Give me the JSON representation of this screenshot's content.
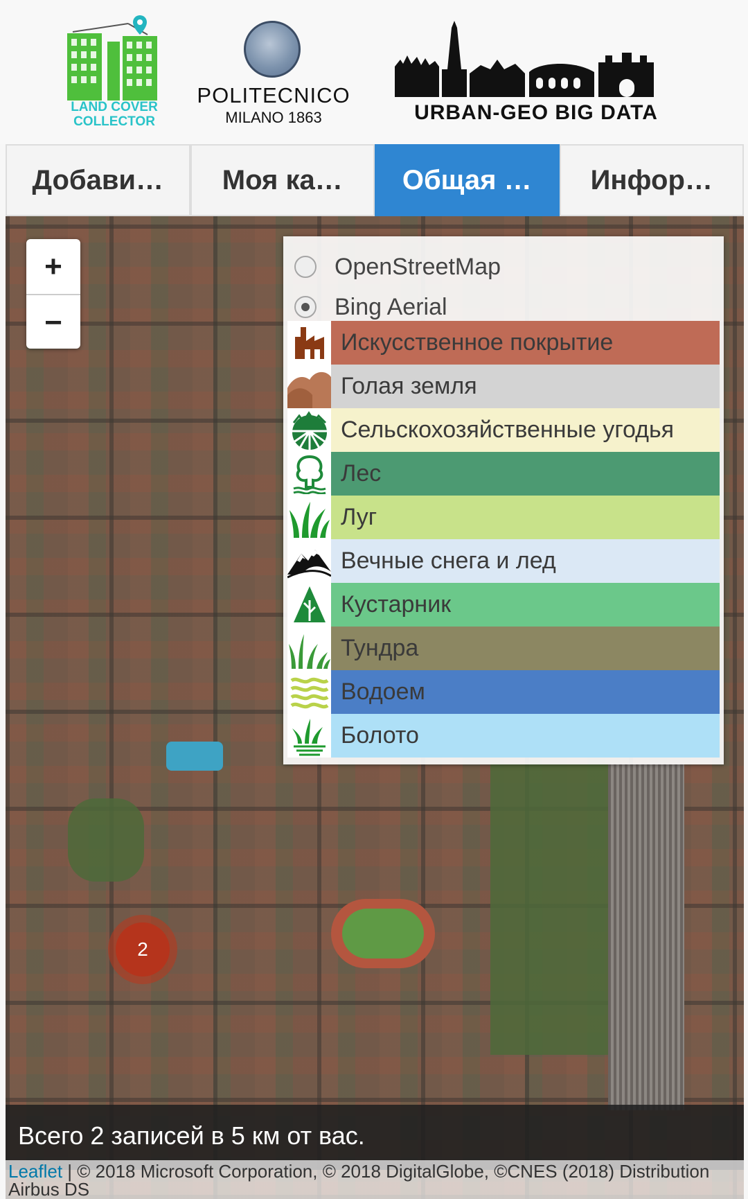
{
  "header": {
    "logo_lcc_text": "LAND COVER COLLECTOR",
    "logo_poli_name": "POLITECNICO",
    "logo_poli_sub": "MILANO 1863",
    "logo_ugbd_text": "URBAN-GEO BIG DATA"
  },
  "tabs": [
    {
      "label": "Добави…",
      "active": false
    },
    {
      "label": "Моя ка…",
      "active": false
    },
    {
      "label": "Общая …",
      "active": true
    },
    {
      "label": "Инфор…",
      "active": false
    }
  ],
  "map": {
    "zoom_in": "+",
    "zoom_out": "−",
    "base_layers": [
      {
        "label": "OpenStreetMap",
        "checked": false
      },
      {
        "label": "Bing Aerial",
        "checked": true
      }
    ],
    "legend": [
      {
        "label": "Искусственное покрытие",
        "color": "#bf6b56",
        "icon": "building-icon"
      },
      {
        "label": "Голая земля",
        "color": "#d3d3d3",
        "icon": "bare-soil-icon"
      },
      {
        "label": "Сельскохозяйственные угодья",
        "color": "#f6f2cc",
        "icon": "farmland-icon"
      },
      {
        "label": "Лес",
        "color": "#4c9a72",
        "icon": "tree-icon"
      },
      {
        "label": "Луг",
        "color": "#c8e28a",
        "icon": "grass-icon"
      },
      {
        "label": "Вечные снега и лед",
        "color": "#dbe8f5",
        "icon": "mountain-icon"
      },
      {
        "label": "Кустарник",
        "color": "#6bc88a",
        "icon": "shrub-icon"
      },
      {
        "label": "Тундра",
        "color": "#8c8762",
        "icon": "tundra-icon"
      },
      {
        "label": "Водоем",
        "color": "#4b7ec6",
        "icon": "water-icon"
      },
      {
        "label": "Болото",
        "color": "#aee0f7",
        "icon": "wetland-icon"
      }
    ],
    "cluster_count": "2",
    "info_text": "Всего 2 записей в 5 км от вас.",
    "attribution_link": "Leaflet",
    "attribution_text": " | © 2018 Microsoft Corporation, © 2018 DigitalGlobe, ©CNES (2018) Distribution Airbus DS"
  }
}
